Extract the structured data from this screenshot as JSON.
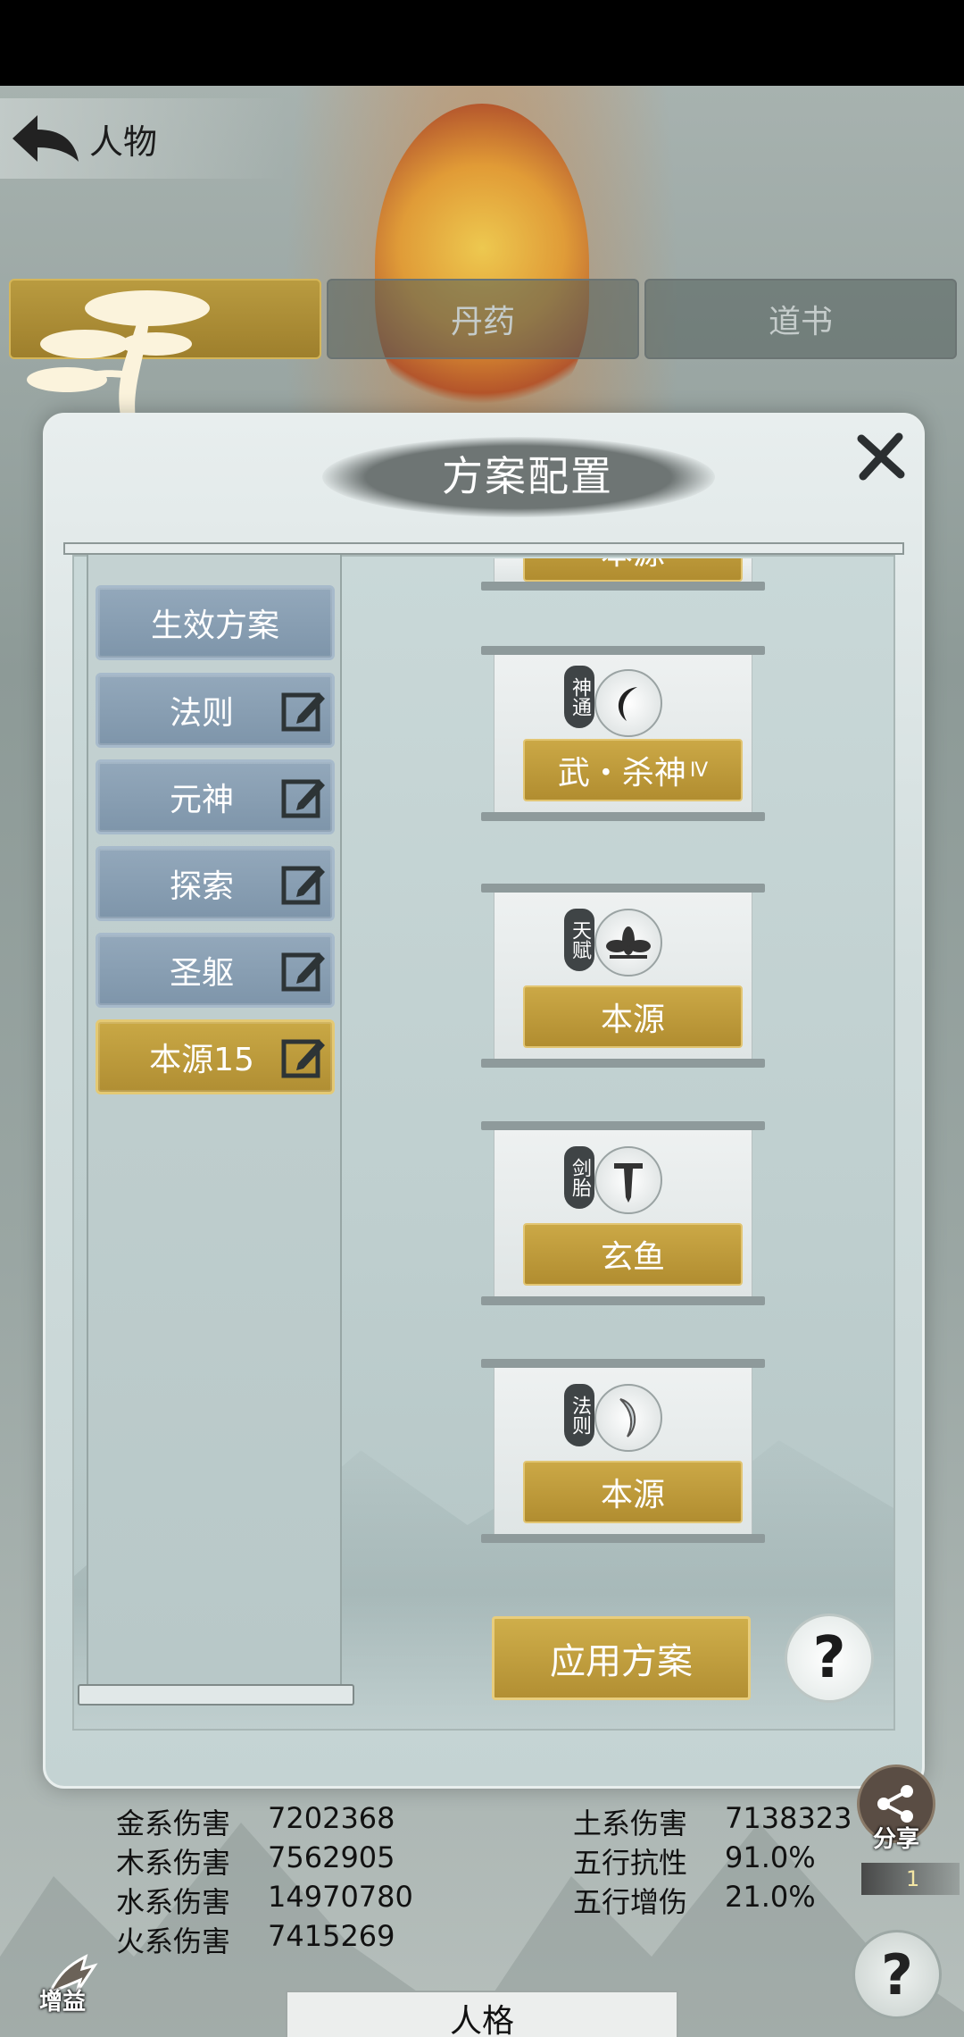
{
  "header": {
    "title": "人物"
  },
  "tabs": [
    {
      "label": "",
      "active": true
    },
    {
      "label": "丹药",
      "active": false
    },
    {
      "label": "道书",
      "active": false
    }
  ],
  "modal": {
    "title": "方案配置",
    "list": [
      {
        "label": "生效方案",
        "editable": false,
        "active": false
      },
      {
        "label": "法则",
        "editable": true,
        "active": false
      },
      {
        "label": "元神",
        "editable": true,
        "active": false
      },
      {
        "label": "探索",
        "editable": true,
        "active": false
      },
      {
        "label": "圣躯",
        "editable": true,
        "active": false
      },
      {
        "label": "本源15",
        "editable": true,
        "active": true
      }
    ],
    "cards": [
      {
        "tag": "",
        "icon": "",
        "button": "本源",
        "sup": ""
      },
      {
        "tag": "神通",
        "icon": "crescent-icon",
        "button": "武・杀神",
        "sup": "Ⅳ"
      },
      {
        "tag": "天赋",
        "icon": "lotus-icon",
        "button": "本源",
        "sup": ""
      },
      {
        "tag": "剑胎",
        "icon": "sword-icon",
        "button": "玄鱼",
        "sup": ""
      },
      {
        "tag": "法则",
        "icon": "fish-icon",
        "button": "本源",
        "sup": ""
      }
    ],
    "apply_label": "应用方案",
    "help_label": "?"
  },
  "stats": {
    "left": [
      {
        "label": "金系伤害",
        "value": "7202368"
      },
      {
        "label": "木系伤害",
        "value": "7562905"
      },
      {
        "label": "水系伤害",
        "value": "14970780"
      },
      {
        "label": "火系伤害",
        "value": "7415269"
      }
    ],
    "right": [
      {
        "label": "土系伤害",
        "value": "7138323"
      },
      {
        "label": "五行抗性",
        "value": "91.0%"
      },
      {
        "label": "五行增伤",
        "value": "21.0%"
      }
    ]
  },
  "bottom": {
    "share_label": "分享",
    "counter": "1",
    "help_label": "?",
    "boost_label": "增益",
    "persona_tab": "人格"
  },
  "colors": {
    "gold": "#b99b40",
    "slate_blue": "#8aa0b4",
    "modal_bg": "#d1dddd"
  }
}
